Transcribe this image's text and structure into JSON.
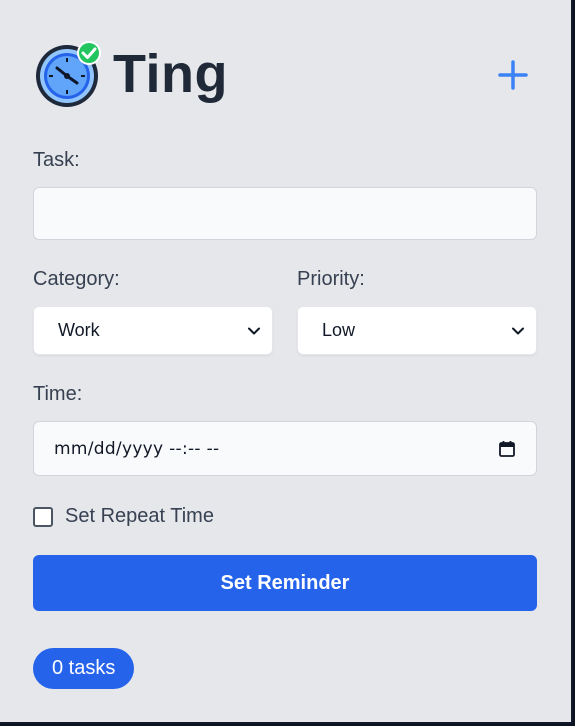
{
  "app": {
    "title": "Ting",
    "logo_icon": "alarm-clock-check-icon"
  },
  "header": {
    "add_icon": "plus-icon"
  },
  "form": {
    "task_label": "Task:",
    "task_value": "",
    "category_label": "Category:",
    "category_value": "Work",
    "priority_label": "Priority:",
    "priority_value": "Low",
    "time_label": "Time:",
    "time_placeholder": "mm/dd/yyyy --:-- --",
    "repeat_label": "Set Repeat Time",
    "repeat_checked": false,
    "submit_label": "Set Reminder"
  },
  "status": {
    "task_count": "0 tasks"
  },
  "colors": {
    "accent": "#2563eb",
    "panel_bg": "#e5e7eb",
    "title": "#1f2937"
  }
}
